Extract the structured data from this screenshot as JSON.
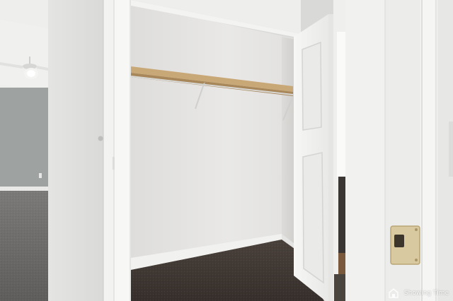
{
  "scene": {
    "description_colors": {
      "wall": "#e6e5e3",
      "closet_interior": "#e8e7e5",
      "bedroom_wall_gray": "#9ea3a1",
      "carpet_bedroom": "#6f6d6b",
      "carpet_closet": "#3f3733",
      "shelf_wood": "#c9a877",
      "door_white": "#f4f4f3",
      "trim_white": "#f2f2f1",
      "hinge_plate": "#d9c9a0"
    }
  },
  "watermark": {
    "icon": "house-icon",
    "text": "Showing Time"
  }
}
